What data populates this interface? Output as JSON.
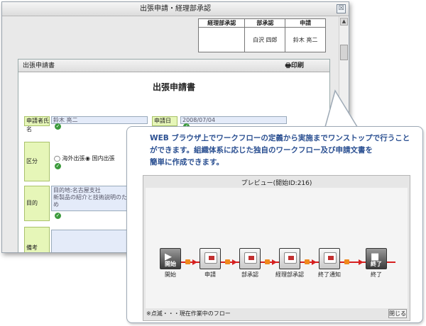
{
  "window": {
    "title": "出張申請・経理部承認",
    "close_glyph": "☒"
  },
  "stamps": {
    "headers": [
      "経理部承認",
      "部承認",
      "申請"
    ],
    "values": [
      "",
      "白沢 四郎",
      "鈴木 亮二"
    ]
  },
  "form": {
    "panel_title": "出張申請書",
    "print_label": "印刷",
    "title": "出張申請書",
    "fields": {
      "applicant_label": "申請者氏名",
      "applicant_value": "鈴木 亮二",
      "date_label": "申請日",
      "date_value": "2008/07/04",
      "category_label": "区分",
      "option_domestic_overseas": "海外出張",
      "option_domestic": "国内出張",
      "purpose_label": "目的",
      "purpose_line1": "目的地:名古屋支社",
      "purpose_line2": "新製品の紹介と技術説明のため",
      "remarks_label": "備考"
    }
  },
  "callout": {
    "line1": "WEB ブラウザ上でワークフローの定義から実施までワンストップで行うこと",
    "line2": "ができます。組織体系に応じた独自のワークフロー及び申請文書を",
    "line3": "簡単に作成できます。"
  },
  "preview": {
    "title": "プレビュー(開始ID:216)",
    "nodes": [
      {
        "label": "開始",
        "inner": "開始",
        "kind": "start"
      },
      {
        "label": "申請",
        "inner": "",
        "kind": "task"
      },
      {
        "label": "部承認",
        "inner": "",
        "kind": "task"
      },
      {
        "label": "経理部承認",
        "inner": "",
        "kind": "task"
      },
      {
        "label": "終了通知",
        "inner": "",
        "kind": "task"
      },
      {
        "label": "終了",
        "inner": "終了",
        "kind": "end"
      }
    ],
    "footnote": "※点滅・・・現在作業中のフロー",
    "close_label": "閉じる"
  }
}
